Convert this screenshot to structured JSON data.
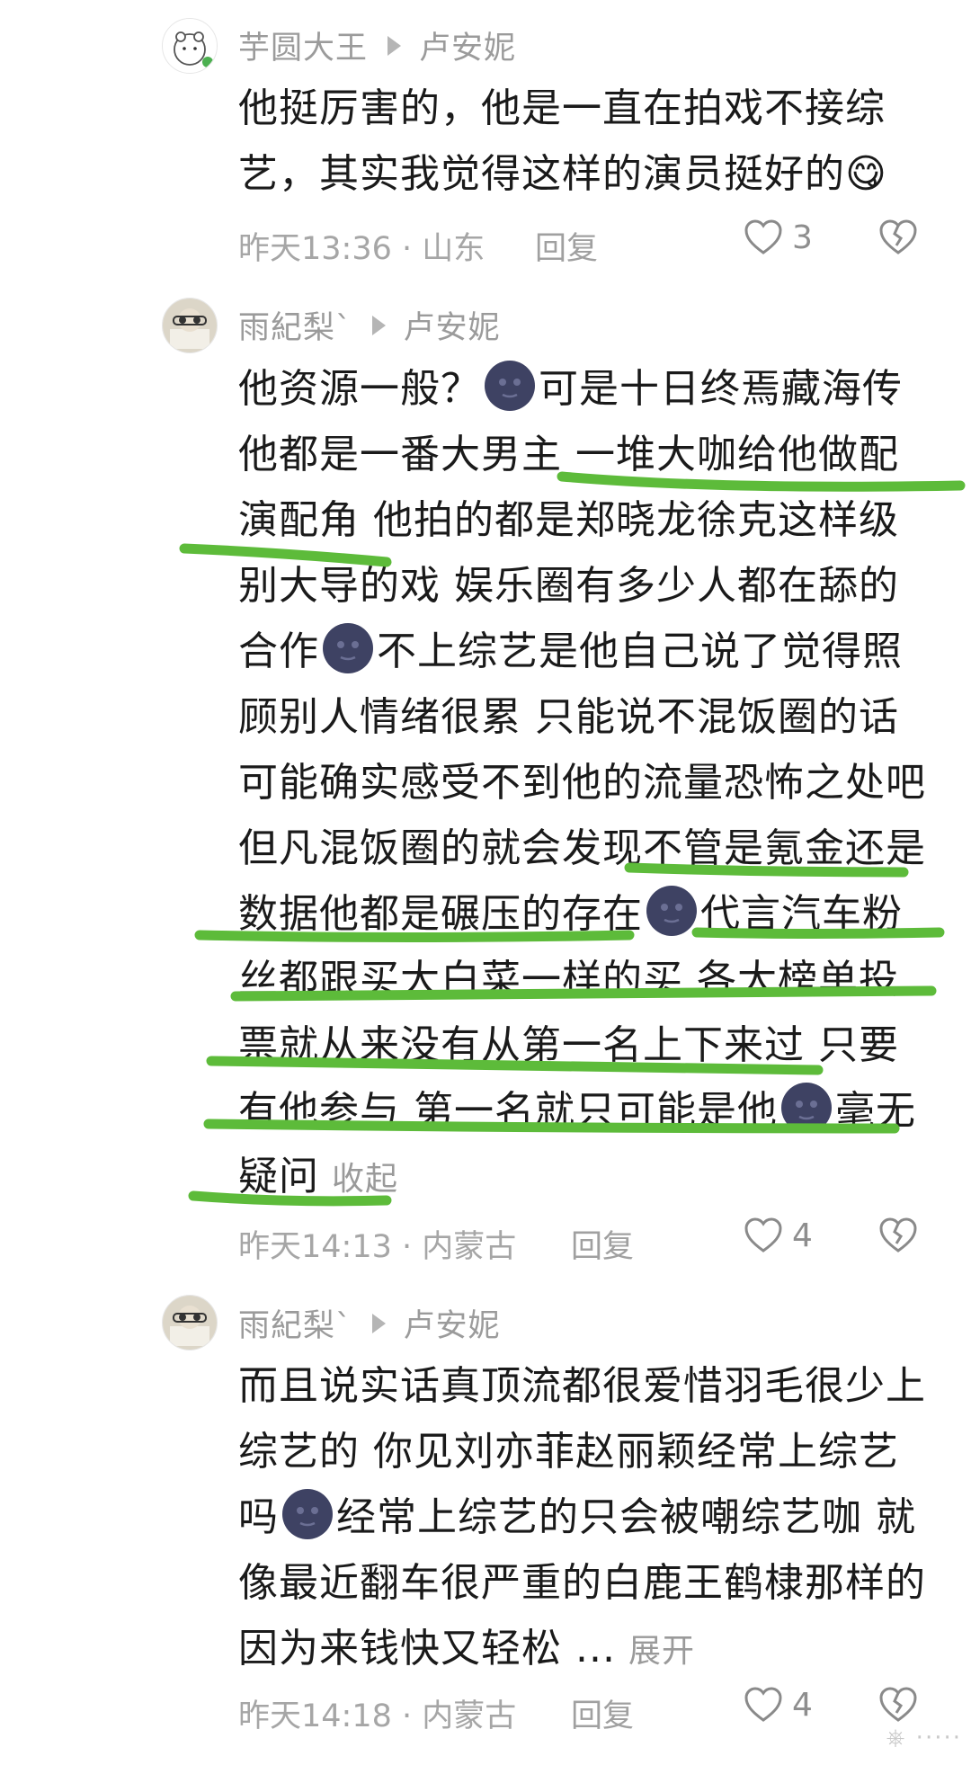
{
  "comments": [
    {
      "user": "芋圆大王",
      "reply_to": "卢安妮",
      "lines": [
        "他挺厉害的，他是一直在拍戏不接综",
        "艺，其实我觉得这样的演员挺好的"
      ],
      "emoji": "😋",
      "time": "昨天13:36 · 山东",
      "reply": "回复",
      "likes": "3"
    },
    {
      "user": "雨紀梨`",
      "reply_to": "卢安妮",
      "lines": [
        "他资源一般？",
        "可是十日终焉藏海传",
        "他都是一番大男主 一堆大咖给他做配",
        "演配角 他拍的都是郑晓龙徐克这样级",
        "别大导的戏 娱乐圈有多少人都在舔的",
        "合作",
        "不上综艺是他自己说了觉得照",
        "顾别人情绪很累 只能说不混饭圈的话",
        "可能确实感受不到他的流量恐怖之处吧",
        "但凡混饭圈的就会发现不管是氪金还是",
        "数据他都是碾压的存在",
        "代言汽车粉",
        "丝都跟买大白菜一样的买 各大榜单投",
        "票就从来没有从第一名上下来过 只要",
        "有他参与 第一名就只可能是他",
        "毫无",
        "疑问"
      ],
      "toggle": "收起",
      "time": "昨天14:13 · 内蒙古",
      "reply": "回复",
      "likes": "4"
    },
    {
      "user": "雨紀梨`",
      "reply_to": "卢安妮",
      "lines": [
        "而且说实话真顶流都很爱惜羽毛很少上",
        "综艺的 你见刘亦菲赵丽颖经常上综艺",
        "吗",
        "经常上综艺的只会被嘲综艺咖 就",
        "像最近翻车很严重的白鹿王鹤棣那样的",
        "因为来钱快又轻松 ..."
      ],
      "toggle": "展开",
      "time": "昨天14:18 · 内蒙古",
      "reply": "回复",
      "likes": "4"
    }
  ],
  "icons": {
    "like": "heart-outline-icon",
    "unlike": "broken-heart-icon",
    "emoji_moon": "new-moon-face-emoji"
  },
  "colors": {
    "highlight": "#5dbb3a",
    "meta": "#a6a6a6"
  }
}
